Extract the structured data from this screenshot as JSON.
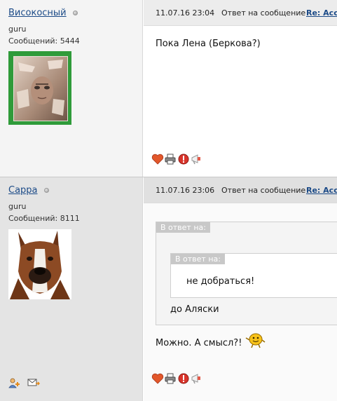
{
  "posts": [
    {
      "username": "Високосный",
      "rank": "guru",
      "messages_label": "Сообщений:",
      "messages_count": "5444",
      "date": "11.07.16 23:04",
      "reply_to_label": "Ответ на сообщение",
      "reply_link": "Re: Acc",
      "text": "Пока Лена (Беркова?)",
      "icons": [
        "heart-icon",
        "print-icon",
        "report-icon",
        "megaphone-icon"
      ]
    },
    {
      "username": "Сарра",
      "rank": "guru",
      "messages_label": "Сообщений:",
      "messages_count": "8111",
      "date": "11.07.16 23:06",
      "reply_to_label": "Ответ на сообщение",
      "reply_link": "Re: Acc",
      "quote_label": "В ответ на:",
      "nested_quote_label": "В ответ на:",
      "nested_quote_text": "не добраться!",
      "quote_text": "до Аляски",
      "text": "Можно. А смысл?!",
      "icons": [
        "heart-icon",
        "print-icon",
        "report-icon",
        "megaphone-icon"
      ],
      "side_icons": [
        "add-friend-icon",
        "send-message-icon"
      ]
    }
  ],
  "colors": {
    "link": "#1b4a87",
    "avatar_frame": "#2f9b3a",
    "heart": "#e2572b",
    "report": "#d9342b"
  }
}
